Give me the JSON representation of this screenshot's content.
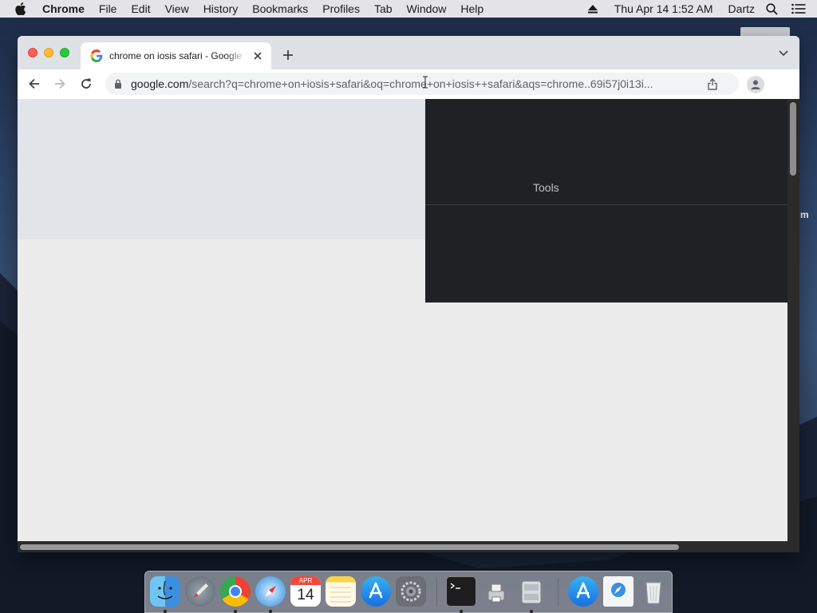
{
  "menubar": {
    "app_name": "Chrome",
    "items": [
      "File",
      "Edit",
      "View",
      "History",
      "Bookmarks",
      "Profiles",
      "Tab",
      "Window",
      "Help"
    ],
    "clock": "Thu Apr 14  1:52 AM",
    "user": "Dartz"
  },
  "desktop": {
    "partial_label": "m"
  },
  "browser": {
    "tab_title": "chrome on iosis safari - Google Search",
    "url_host": "google.com",
    "url_path": "/search?q=chrome+on+iosis+safari&oq=chrome+on+iosis++safari&aqs=chrome..69i57j0i13i..."
  },
  "page": {
    "tools_label": "Tools"
  },
  "dock": {
    "apps": [
      "Finder",
      "Launchpad",
      "Google Chrome",
      "Safari",
      "Calendar",
      "Notes",
      "App Store",
      "System Preferences",
      "Terminal",
      "Automator",
      "Disk Utility",
      "App Store",
      "Downloads",
      "Trash"
    ],
    "calendar_month": "APR",
    "calendar_day": "14"
  }
}
